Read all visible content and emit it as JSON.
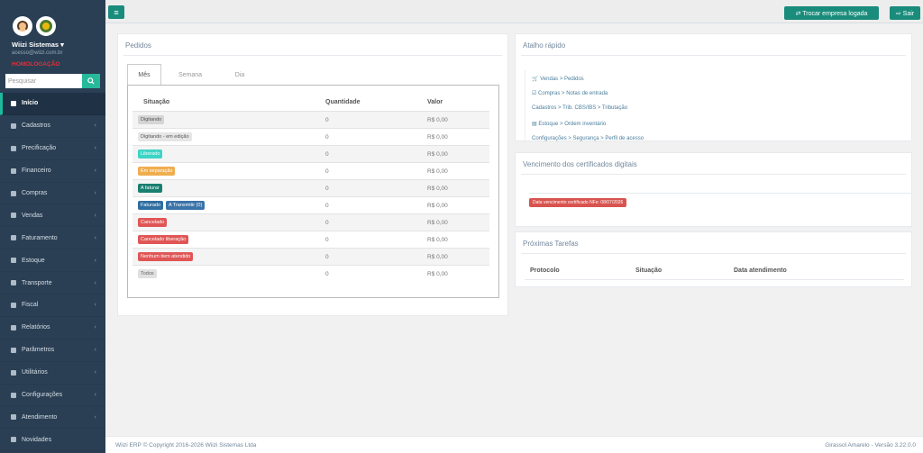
{
  "sidebar": {
    "user_name": "Wiizi Sistemas",
    "user_email": "acesso@wiizi.com.br",
    "env_label": "HOMOLOGAÇÃO",
    "search_placeholder": "Pesquisar",
    "items": [
      {
        "label": "Início",
        "icon": "home-icon",
        "active": true
      },
      {
        "label": "Cadastros",
        "icon": "table-icon"
      },
      {
        "label": "Precificação",
        "icon": "price-icon"
      },
      {
        "label": "Financeiro",
        "icon": "money-icon"
      },
      {
        "label": "Compras",
        "icon": "cart-icon"
      },
      {
        "label": "Vendas",
        "icon": "bag-icon"
      },
      {
        "label": "Faturamento",
        "icon": "chart-icon"
      },
      {
        "label": "Estoque",
        "icon": "box-icon"
      },
      {
        "label": "Transporte",
        "icon": "truck-icon"
      },
      {
        "label": "Fiscal",
        "icon": "fiscal-icon"
      },
      {
        "label": "Relatórios",
        "icon": "report-icon"
      },
      {
        "label": "Parâmetros",
        "icon": "sliders-icon"
      },
      {
        "label": "Utilitários",
        "icon": "tools-icon"
      },
      {
        "label": "Configurações",
        "icon": "gear-icon"
      },
      {
        "label": "Atendimento",
        "icon": "chat-icon"
      },
      {
        "label": "Novidades",
        "icon": "info-icon"
      }
    ]
  },
  "topbar": {
    "toggle_label": "≡",
    "trocar_label": "⇄ Trocar empresa logada",
    "sair_label": "⇨ Sair"
  },
  "pedidos": {
    "title": "Pedidos",
    "tabs": [
      "Mês",
      "Semana",
      "Dia"
    ],
    "headers": {
      "situacao": "Situação",
      "quantidade": "Quantidade",
      "valor": "Valor"
    },
    "rows": [
      {
        "badges": [
          {
            "label": "Digitando",
            "color": "#d5d5d5",
            "text": "#555"
          }
        ],
        "qtd": "0",
        "valor": "R$ 0,00"
      },
      {
        "badges": [
          {
            "label": "Digitando - em edição",
            "color": "#e6e6e6",
            "text": "#555"
          }
        ],
        "qtd": "0",
        "valor": "R$ 0,00"
      },
      {
        "badges": [
          {
            "label": "Liberado",
            "color": "#3dd4c5",
            "text": "#fff"
          }
        ],
        "qtd": "0",
        "valor": "R$ 0,00"
      },
      {
        "badges": [
          {
            "label": "Em separação",
            "color": "#f0ad4e",
            "text": "#fff"
          }
        ],
        "qtd": "0",
        "valor": "R$ 0,00"
      },
      {
        "badges": [
          {
            "label": "A faturar",
            "color": "#1a7f6f",
            "text": "#fff"
          }
        ],
        "qtd": "0",
        "valor": "R$ 0,00"
      },
      {
        "badges": [
          {
            "label": "Faturado",
            "color": "#2f6ea0",
            "text": "#fff"
          },
          {
            "label": "A Transmitir (0)",
            "color": "#3a73a8",
            "text": "#fff"
          }
        ],
        "qtd": "0",
        "valor": "R$ 0,00"
      },
      {
        "badges": [
          {
            "label": "Cancelado",
            "color": "#e05656",
            "text": "#fff"
          }
        ],
        "qtd": "0",
        "valor": "R$ 0,00"
      },
      {
        "badges": [
          {
            "label": "Cancelado liberação",
            "color": "#e05656",
            "text": "#fff"
          }
        ],
        "qtd": "0",
        "valor": "R$ 0,00"
      },
      {
        "badges": [
          {
            "label": "Nenhum item atendido",
            "color": "#e05656",
            "text": "#fff"
          }
        ],
        "qtd": "0",
        "valor": "R$ 0,00"
      },
      {
        "badges": [
          {
            "label": "Todos",
            "color": "#e0e0e0",
            "text": "#666"
          }
        ],
        "qtd": "0",
        "valor": "R$ 0,00"
      }
    ]
  },
  "atalho": {
    "title": "Atalho rápido",
    "links": [
      "🛒 Vendas > Pedidos",
      "☑ Compras > Notas de entrada",
      "Cadastros > Trib. CBS/IBS > Tributação",
      "▤ Estoque > Ordem inventário",
      "Configurações > Segurança > Perfil de acesso"
    ]
  },
  "vencimento": {
    "title": "Vencimento dos certificados digitais",
    "badge": "Data vencimento certificado NFe: 08/07/2026"
  },
  "tarefas": {
    "title": "Próximas Tarefas",
    "headers": [
      "Protocolo",
      "Situação",
      "Data atendimento"
    ]
  },
  "footer": {
    "left": "Wiizi ERP © Copyright 2016-2026 Wiizi Sistemas Ltda",
    "right": "Girassol Amarelo - Versão 3.22.0.0"
  }
}
